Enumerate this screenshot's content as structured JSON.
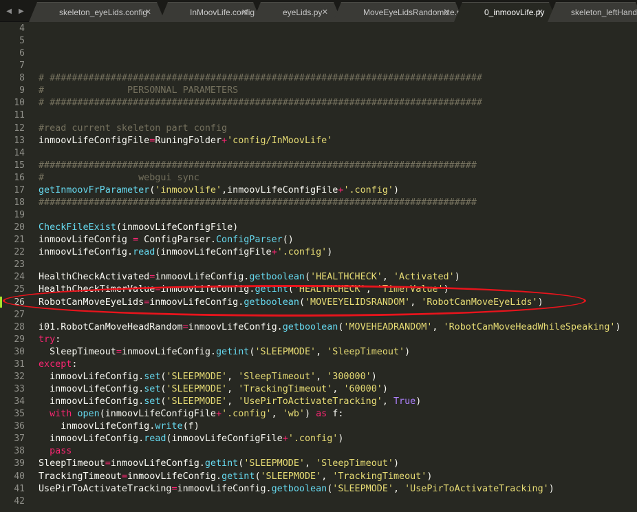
{
  "tabs": [
    {
      "label": "skeleton_eyeLids.config",
      "active": false
    },
    {
      "label": "InMoovLife.config",
      "active": false
    },
    {
      "label": "eyeLids.py",
      "active": false
    },
    {
      "label": "MoveEyeLidsRandomize.py",
      "active": false
    },
    {
      "label": "0_inmoovLife.py",
      "active": true
    },
    {
      "label": "skeleton_leftHand.co",
      "active": false
    }
  ],
  "icons": {
    "nav_back": "◀",
    "nav_forward": "▶",
    "close": "✕"
  },
  "colors": {
    "background": "#272822",
    "comment": "#75715e",
    "function": "#66d9ef",
    "string": "#e6db74",
    "operator": "#f92672",
    "constant": "#ae81ff",
    "annotation": "#e8141c"
  },
  "code_lines": [
    {
      "n": "4",
      "tokens": []
    },
    {
      "n": "5",
      "tokens": []
    },
    {
      "n": "6",
      "tokens": []
    },
    {
      "n": "7",
      "tokens": []
    },
    {
      "n": "8",
      "tokens": [
        [
          "c",
          "# ##############################################################################"
        ]
      ]
    },
    {
      "n": "9",
      "tokens": [
        [
          "c",
          "#               PERSONNAL PARAMETERS"
        ]
      ]
    },
    {
      "n": "10",
      "tokens": [
        [
          "c",
          "# ##############################################################################"
        ]
      ]
    },
    {
      "n": "11",
      "tokens": []
    },
    {
      "n": "12",
      "tokens": [
        [
          "c",
          "#read current skeleton part config"
        ]
      ]
    },
    {
      "n": "13",
      "tokens": [
        [
          "t",
          "inmoovLifeConfigFile"
        ],
        [
          "o",
          "="
        ],
        [
          "t",
          "RuningFolder"
        ],
        [
          "o",
          "+"
        ],
        [
          "s",
          "'config/InMoovLife'"
        ]
      ]
    },
    {
      "n": "14",
      "tokens": []
    },
    {
      "n": "15",
      "tokens": [
        [
          "c",
          "###############################################################################"
        ]
      ]
    },
    {
      "n": "16",
      "tokens": [
        [
          "c",
          "#                 webgui sync"
        ]
      ]
    },
    {
      "n": "17",
      "tokens": [
        [
          "f",
          "getInmoovFrParameter"
        ],
        [
          "t",
          "("
        ],
        [
          "s",
          "'inmoovlife'"
        ],
        [
          "t",
          ",inmoovLifeConfigFile"
        ],
        [
          "o",
          "+"
        ],
        [
          "s",
          "'.config'"
        ],
        [
          "t",
          ")"
        ]
      ]
    },
    {
      "n": "18",
      "tokens": [
        [
          "c",
          "###############################################################################"
        ]
      ]
    },
    {
      "n": "19",
      "tokens": []
    },
    {
      "n": "20",
      "tokens": [
        [
          "f",
          "CheckFileExist"
        ],
        [
          "t",
          "(inmoovLifeConfigFile)"
        ]
      ]
    },
    {
      "n": "21",
      "tokens": [
        [
          "t",
          "inmoovLifeConfig "
        ],
        [
          "o",
          "="
        ],
        [
          "t",
          " ConfigParser."
        ],
        [
          "f",
          "ConfigParser"
        ],
        [
          "t",
          "()"
        ]
      ]
    },
    {
      "n": "22",
      "tokens": [
        [
          "t",
          "inmoovLifeConfig."
        ],
        [
          "f",
          "read"
        ],
        [
          "t",
          "(inmoovLifeConfigFile"
        ],
        [
          "o",
          "+"
        ],
        [
          "s",
          "'.config'"
        ],
        [
          "t",
          ")"
        ]
      ]
    },
    {
      "n": "23",
      "tokens": []
    },
    {
      "n": "24",
      "tokens": [
        [
          "t",
          "HealthCheckActivated"
        ],
        [
          "o",
          "="
        ],
        [
          "t",
          "inmoovLifeConfig."
        ],
        [
          "f",
          "getboolean"
        ],
        [
          "t",
          "("
        ],
        [
          "s",
          "'HEALTHCHECK'"
        ],
        [
          "t",
          ", "
        ],
        [
          "s",
          "'Activated'"
        ],
        [
          "t",
          ")"
        ]
      ]
    },
    {
      "n": "25",
      "tokens": [
        [
          "t",
          "HealthCheckTimerValue"
        ],
        [
          "o",
          "="
        ],
        [
          "t",
          "inmoovLifeConfig."
        ],
        [
          "f",
          "getint"
        ],
        [
          "t",
          "("
        ],
        [
          "s",
          "'HEALTHCHECK'"
        ],
        [
          "t",
          ", "
        ],
        [
          "s",
          "'TimerValue'"
        ],
        [
          "t",
          ")"
        ]
      ]
    },
    {
      "n": "26",
      "current": true,
      "tokens": [
        [
          "t",
          "RobotCanMoveEyeLids"
        ],
        [
          "o",
          "="
        ],
        [
          "t",
          "inmoovLifeConfig."
        ],
        [
          "f",
          "getboolean"
        ],
        [
          "t",
          "("
        ],
        [
          "s",
          "'MOVEEYELIDSRANDOM'"
        ],
        [
          "t",
          ", "
        ],
        [
          "s",
          "'RobotCanMoveEyeLids'"
        ],
        [
          "t",
          ")"
        ]
      ]
    },
    {
      "n": "27",
      "tokens": []
    },
    {
      "n": "28",
      "tokens": [
        [
          "t",
          "i01.RobotCanMoveHeadRandom"
        ],
        [
          "o",
          "="
        ],
        [
          "t",
          "inmoovLifeConfig."
        ],
        [
          "f",
          "getboolean"
        ],
        [
          "t",
          "("
        ],
        [
          "s",
          "'MOVEHEADRANDOM'"
        ],
        [
          "t",
          ", "
        ],
        [
          "s",
          "'RobotCanMoveHeadWhileSpeaking'"
        ],
        [
          "t",
          ")"
        ]
      ]
    },
    {
      "n": "29",
      "tokens": [
        [
          "o",
          "try"
        ],
        [
          "t",
          ":"
        ]
      ]
    },
    {
      "n": "30",
      "tokens": [
        [
          "t",
          "  SleepTimeout"
        ],
        [
          "o",
          "="
        ],
        [
          "t",
          "inmoovLifeConfig."
        ],
        [
          "f",
          "getint"
        ],
        [
          "t",
          "("
        ],
        [
          "s",
          "'SLEEPMODE'"
        ],
        [
          "t",
          ", "
        ],
        [
          "s",
          "'SleepTimeout'"
        ],
        [
          "t",
          ")"
        ]
      ]
    },
    {
      "n": "31",
      "tokens": [
        [
          "o",
          "except"
        ],
        [
          "t",
          ":"
        ]
      ]
    },
    {
      "n": "32",
      "tokens": [
        [
          "t",
          "  inmoovLifeConfig."
        ],
        [
          "f",
          "set"
        ],
        [
          "t",
          "("
        ],
        [
          "s",
          "'SLEEPMODE'"
        ],
        [
          "t",
          ", "
        ],
        [
          "s",
          "'SleepTimeout'"
        ],
        [
          "t",
          ", "
        ],
        [
          "s",
          "'300000'"
        ],
        [
          "t",
          ")"
        ]
      ]
    },
    {
      "n": "33",
      "tokens": [
        [
          "t",
          "  inmoovLifeConfig."
        ],
        [
          "f",
          "set"
        ],
        [
          "t",
          "("
        ],
        [
          "s",
          "'SLEEPMODE'"
        ],
        [
          "t",
          ", "
        ],
        [
          "s",
          "'TrackingTimeout'"
        ],
        [
          "t",
          ", "
        ],
        [
          "s",
          "'60000'"
        ],
        [
          "t",
          ")"
        ]
      ]
    },
    {
      "n": "34",
      "tokens": [
        [
          "t",
          "  inmoovLifeConfig."
        ],
        [
          "f",
          "set"
        ],
        [
          "t",
          "("
        ],
        [
          "s",
          "'SLEEPMODE'"
        ],
        [
          "t",
          ", "
        ],
        [
          "s",
          "'UsePirToActivateTracking'"
        ],
        [
          "t",
          ", "
        ],
        [
          "n",
          "True"
        ],
        [
          "t",
          ")"
        ]
      ]
    },
    {
      "n": "35",
      "tokens": [
        [
          "t",
          "  "
        ],
        [
          "o",
          "with"
        ],
        [
          "t",
          " "
        ],
        [
          "f",
          "open"
        ],
        [
          "t",
          "(inmoovLifeConfigFile"
        ],
        [
          "o",
          "+"
        ],
        [
          "s",
          "'.config'"
        ],
        [
          "t",
          ", "
        ],
        [
          "s",
          "'wb'"
        ],
        [
          "t",
          ") "
        ],
        [
          "o",
          "as"
        ],
        [
          "t",
          " f:"
        ]
      ]
    },
    {
      "n": "36",
      "tokens": [
        [
          "t",
          "    inmoovLifeConfig."
        ],
        [
          "f",
          "write"
        ],
        [
          "t",
          "(f)"
        ]
      ]
    },
    {
      "n": "37",
      "tokens": [
        [
          "t",
          "  inmoovLifeConfig."
        ],
        [
          "f",
          "read"
        ],
        [
          "t",
          "(inmoovLifeConfigFile"
        ],
        [
          "o",
          "+"
        ],
        [
          "s",
          "'.config'"
        ],
        [
          "t",
          ")"
        ]
      ]
    },
    {
      "n": "38",
      "tokens": [
        [
          "t",
          "  "
        ],
        [
          "o",
          "pass"
        ]
      ]
    },
    {
      "n": "39",
      "tokens": [
        [
          "t",
          "SleepTimeout"
        ],
        [
          "o",
          "="
        ],
        [
          "t",
          "inmoovLifeConfig."
        ],
        [
          "f",
          "getint"
        ],
        [
          "t",
          "("
        ],
        [
          "s",
          "'SLEEPMODE'"
        ],
        [
          "t",
          ", "
        ],
        [
          "s",
          "'SleepTimeout'"
        ],
        [
          "t",
          ")"
        ]
      ]
    },
    {
      "n": "40",
      "tokens": [
        [
          "t",
          "TrackingTimeout"
        ],
        [
          "o",
          "="
        ],
        [
          "t",
          "inmoovLifeConfig."
        ],
        [
          "f",
          "getint"
        ],
        [
          "t",
          "("
        ],
        [
          "s",
          "'SLEEPMODE'"
        ],
        [
          "t",
          ", "
        ],
        [
          "s",
          "'TrackingTimeout'"
        ],
        [
          "t",
          ")"
        ]
      ]
    },
    {
      "n": "41",
      "tokens": [
        [
          "t",
          "UsePirToActivateTracking"
        ],
        [
          "o",
          "="
        ],
        [
          "t",
          "inmoovLifeConfig."
        ],
        [
          "f",
          "getboolean"
        ],
        [
          "t",
          "("
        ],
        [
          "s",
          "'SLEEPMODE'"
        ],
        [
          "t",
          ", "
        ],
        [
          "s",
          "'UsePirToActivateTracking'"
        ],
        [
          "t",
          ")"
        ]
      ]
    },
    {
      "n": "42",
      "tokens": []
    }
  ]
}
